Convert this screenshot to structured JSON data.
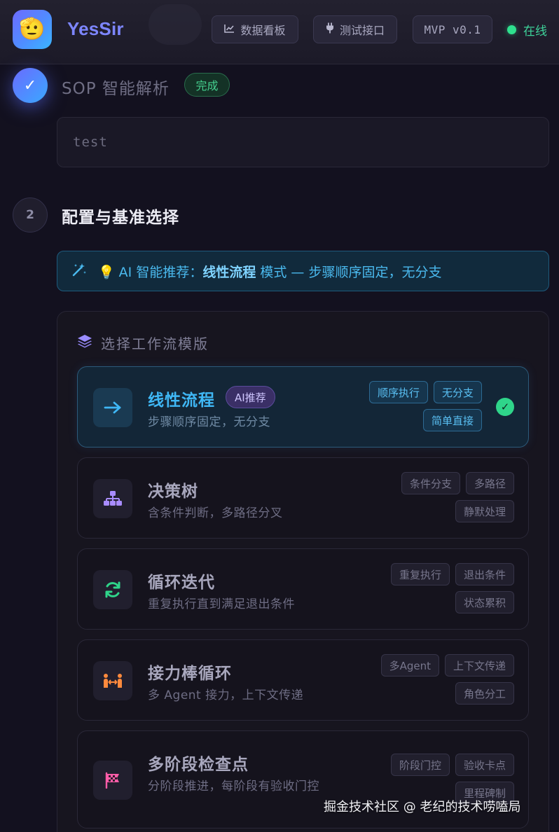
{
  "header": {
    "logo_icon": "🫡",
    "brand": "YesSir",
    "dashboard_label": "数据看板",
    "dashboard_icon": "chart-line-icon",
    "api_test_label": "测试接口",
    "api_test_icon": "plug-icon",
    "version": "MVP v0.1",
    "status": "在线",
    "status_color": "#2fe08e"
  },
  "step1": {
    "check": "✓",
    "title": "SOP 智能解析",
    "badge": "完成",
    "content": "test"
  },
  "step2": {
    "number": "2",
    "title": "配置与基准选择",
    "recommendation": {
      "prefix": "AI 智能推荐：",
      "mode": "线性流程",
      "suffix": " 模式 — 步骤顺序固定，无分支"
    },
    "template_heading": "选择工作流模版",
    "templates": [
      {
        "name": "线性流程",
        "badge": "AI推荐",
        "desc": "步骤顺序固定，无分支",
        "tags": [
          "顺序执行",
          "无分支",
          "简单直接"
        ],
        "icon": "arrow-right-icon",
        "glyph": "→",
        "selected": true
      },
      {
        "name": "决策树",
        "desc": "含条件判断，多路径分叉",
        "tags": [
          "条件分支",
          "多路径",
          "静默处理"
        ],
        "icon": "sitemap-icon",
        "glyph": "⚇"
      },
      {
        "name": "循环迭代",
        "desc": "重复执行直到满足退出条件",
        "tags": [
          "重复执行",
          "退出条件",
          "状态累积"
        ],
        "icon": "sync-icon",
        "glyph": "⟳"
      },
      {
        "name": "接力棒循环",
        "desc": "多 Agent 接力，上下文传递",
        "tags": [
          "多Agent",
          "上下文传递",
          "角色分工"
        ],
        "icon": "people-arrows-icon",
        "glyph": "⇄"
      },
      {
        "name": "多阶段检查点",
        "desc": "分阶段推进，每阶段有验收门控",
        "tags": [
          "阶段门控",
          "验收卡点",
          "里程碑制"
        ],
        "icon": "checkered-flag-icon",
        "glyph": "⚑"
      }
    ]
  },
  "watermark": "掘金技术社区 @ 老纪的技术唠嗑局",
  "colors": {
    "accent": "#3fb7f5",
    "success": "#2fd58a",
    "purple": "#9a8cff"
  }
}
